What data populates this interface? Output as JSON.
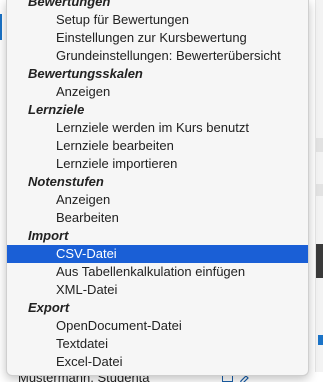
{
  "background": {
    "footer_text": "Mustermann, Studenta"
  },
  "menu": {
    "rows": [
      {
        "type": "header",
        "label": "Bewertungen"
      },
      {
        "type": "item",
        "label": "Setup für Bewertungen"
      },
      {
        "type": "item",
        "label": "Einstellungen zur Kursbewertung"
      },
      {
        "type": "item",
        "label": "Grundeinstellungen: Bewerterübersicht"
      },
      {
        "type": "header",
        "label": "Bewertungsskalen"
      },
      {
        "type": "item",
        "label": "Anzeigen"
      },
      {
        "type": "header",
        "label": "Lernziele"
      },
      {
        "type": "item",
        "label": "Lernziele werden im Kurs benutzt"
      },
      {
        "type": "item",
        "label": "Lernziele bearbeiten"
      },
      {
        "type": "item",
        "label": "Lernziele importieren"
      },
      {
        "type": "header",
        "label": "Notenstufen"
      },
      {
        "type": "item",
        "label": "Anzeigen"
      },
      {
        "type": "item",
        "label": "Bearbeiten"
      },
      {
        "type": "header",
        "label": "Import"
      },
      {
        "type": "item",
        "label": "CSV-Datei",
        "selected": true
      },
      {
        "type": "item",
        "label": "Aus Tabellenkalkulation einfügen"
      },
      {
        "type": "item",
        "label": "XML-Datei"
      },
      {
        "type": "header",
        "label": "Export"
      },
      {
        "type": "item",
        "label": "OpenDocument-Datei"
      },
      {
        "type": "item",
        "label": "Textdatei"
      },
      {
        "type": "item",
        "label": "Excel-Datei"
      }
    ]
  },
  "colors": {
    "selection": "#1a5fd6",
    "menu_background": "#f6f6f6",
    "link": "#1a73c7"
  }
}
